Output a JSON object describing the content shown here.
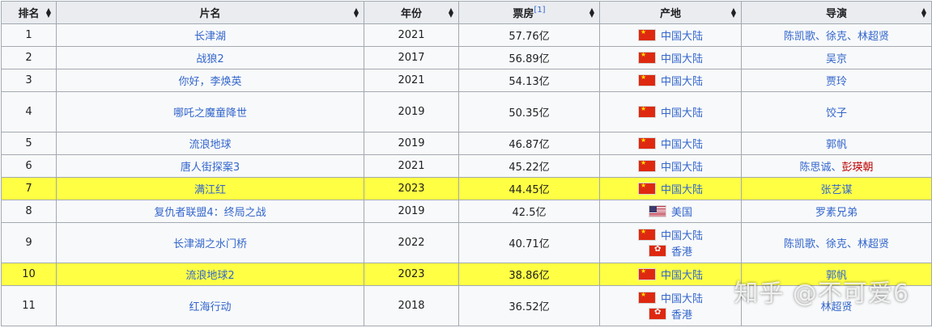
{
  "header": {
    "rank": "排名",
    "title": "片名",
    "year": "年份",
    "box_office": "票房",
    "box_office_ref": "[1]",
    "origin": "产地",
    "director": "导演"
  },
  "rows": [
    {
      "rank": "1",
      "title": "长津湖",
      "year": "2021",
      "box": "57.76亿",
      "origins": [
        {
          "flag": "cn-flag",
          "name": "中国大陆"
        }
      ],
      "director": [
        "陈凯歌、徐克、林超贤"
      ]
    },
    {
      "rank": "2",
      "title": "战狼2",
      "year": "2017",
      "box": "56.89亿",
      "origins": [
        {
          "flag": "cn-flag",
          "name": "中国大陆"
        }
      ],
      "director": [
        "吴京"
      ]
    },
    {
      "rank": "3",
      "title": "你好，李焕英",
      "year": "2021",
      "box": "54.13亿",
      "origins": [
        {
          "flag": "cn-flag",
          "name": "中国大陆"
        }
      ],
      "director": [
        "贾玲"
      ]
    },
    {
      "rank": "4",
      "title": "哪吒之魔童降世",
      "year": "2019",
      "box": "50.35亿",
      "origins": [
        {
          "flag": "cn-flag",
          "name": "中国大陆"
        }
      ],
      "director": [
        "饺子"
      ]
    },
    {
      "rank": "5",
      "title": "流浪地球",
      "year": "2019",
      "box": "46.87亿",
      "origins": [
        {
          "flag": "cn-flag",
          "name": "中国大陆"
        }
      ],
      "director": [
        "郭帆"
      ]
    },
    {
      "rank": "6",
      "title": "唐人街探案3",
      "year": "2021",
      "box": "45.22亿",
      "origins": [
        {
          "flag": "cn-flag",
          "name": "中国大陆"
        }
      ],
      "director": [
        "陈思诚、",
        "彭瑛朝"
      ]
    },
    {
      "rank": "7",
      "title": "满江红",
      "year": "2023",
      "box": "44.45亿",
      "origins": [
        {
          "flag": "cn-flag",
          "name": "中国大陆"
        }
      ],
      "director": [
        "张艺谋"
      ]
    },
    {
      "rank": "8",
      "title": "复仇者联盟4：终局之战",
      "year": "2019",
      "box": "42.5亿",
      "origins": [
        {
          "flag": "us-flag",
          "name": "美国"
        }
      ],
      "director": [
        "罗素兄弟"
      ]
    },
    {
      "rank": "9",
      "title": "长津湖之水门桥",
      "year": "2022",
      "box": "40.71亿",
      "origins": [
        {
          "flag": "cn-flag",
          "name": "中国大陆"
        },
        {
          "flag": "hk-flag",
          "name": "香港"
        }
      ],
      "director": [
        "陈凯歌、徐克、林超贤"
      ]
    },
    {
      "rank": "10",
      "title": "流浪地球2",
      "year": "2023",
      "box": "38.86亿",
      "origins": [
        {
          "flag": "cn-flag",
          "name": "中国大陆"
        }
      ],
      "director": [
        "郭帆"
      ]
    },
    {
      "rank": "11",
      "title": "红海行动",
      "year": "2018",
      "box": "36.52亿",
      "origins": [
        {
          "flag": "cn-flag",
          "name": "中国大陆"
        },
        {
          "flag": "hk-flag",
          "name": "香港"
        }
      ],
      "director": [
        "林超贤"
      ]
    }
  ],
  "watermark": "知乎 @不可爱6",
  "colors": {
    "highlight": "#ffff44",
    "link": "#3366cc",
    "redlink": "#ba0000",
    "header_bg": "#eaecf0",
    "border": "#a2a9b1"
  },
  "icons": {
    "sort": "sort-arrows-icon"
  }
}
